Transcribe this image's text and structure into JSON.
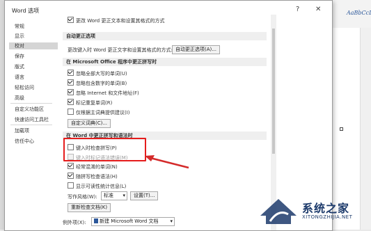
{
  "window": {
    "title": "Word 选项",
    "help_glyph": "?",
    "close_glyph": "✕"
  },
  "nav": {
    "items": [
      {
        "label": "常规"
      },
      {
        "label": "显示"
      },
      {
        "label": "校对"
      },
      {
        "label": "保存"
      },
      {
        "label": "版式"
      },
      {
        "label": "语言"
      },
      {
        "label": "轻松访问"
      },
      {
        "label": "高级"
      },
      {
        "label": "自定义功能区"
      },
      {
        "label": "快速访问工具栏"
      },
      {
        "label": "加载项"
      },
      {
        "label": "信任中心"
      }
    ],
    "selected": "校对"
  },
  "top_cut": {
    "label": "更改 Word 更正文本和设置其格式的方式"
  },
  "autocorrect": {
    "header": "自动更正选项",
    "description": "更改键入时 Word 更正文字和设置其格式的方式:",
    "button": "自动更正选项(A)..."
  },
  "office": {
    "header": "在 Microsoft Office 程序中更正拼写时",
    "options": [
      {
        "label": "忽略全部大写的单词(U)",
        "checked": true
      },
      {
        "label": "忽略包含数字的单词(B)",
        "checked": true
      },
      {
        "label": "忽略 Internet 和文件地址(F)",
        "checked": true
      },
      {
        "label": "标记重复单词(R)",
        "checked": true
      },
      {
        "label": "仅根据主词典提供建议(I)",
        "checked": false
      }
    ],
    "dict_button": "自定义词典(C)..."
  },
  "word": {
    "header": "在 Word 中更正拼写和语法时",
    "options": [
      {
        "label": "键入时检查拼写(P)",
        "checked": false,
        "disabled": false
      },
      {
        "label": "键入时标记语法错误(M)",
        "checked": false,
        "disabled": true
      },
      {
        "label": "经常混淆的单词(N)",
        "checked": true,
        "disabled": false
      },
      {
        "label": "随拼写检查语法(H)",
        "checked": true,
        "disabled": false
      },
      {
        "label": "显示可读性统计信息(L)",
        "checked": false,
        "disabled": false
      }
    ],
    "style_label": "写作风格(W):",
    "style_value": "标准",
    "settings_button": "设置(T)...",
    "recheck_button": "重新检查文档(K)"
  },
  "exceptions": {
    "label": "例外项(X):",
    "doc_value": "新建 Microsoft Word 文档"
  },
  "document": {
    "style_sample": "AaBbCcD"
  },
  "watermark": {
    "cn": "系统之家",
    "en": "XITONGZHIJIA.NET"
  },
  "colors": {
    "highlight": "#e51c1c",
    "arrow": "#d42a2a",
    "watermark": "#1c3a6b"
  }
}
